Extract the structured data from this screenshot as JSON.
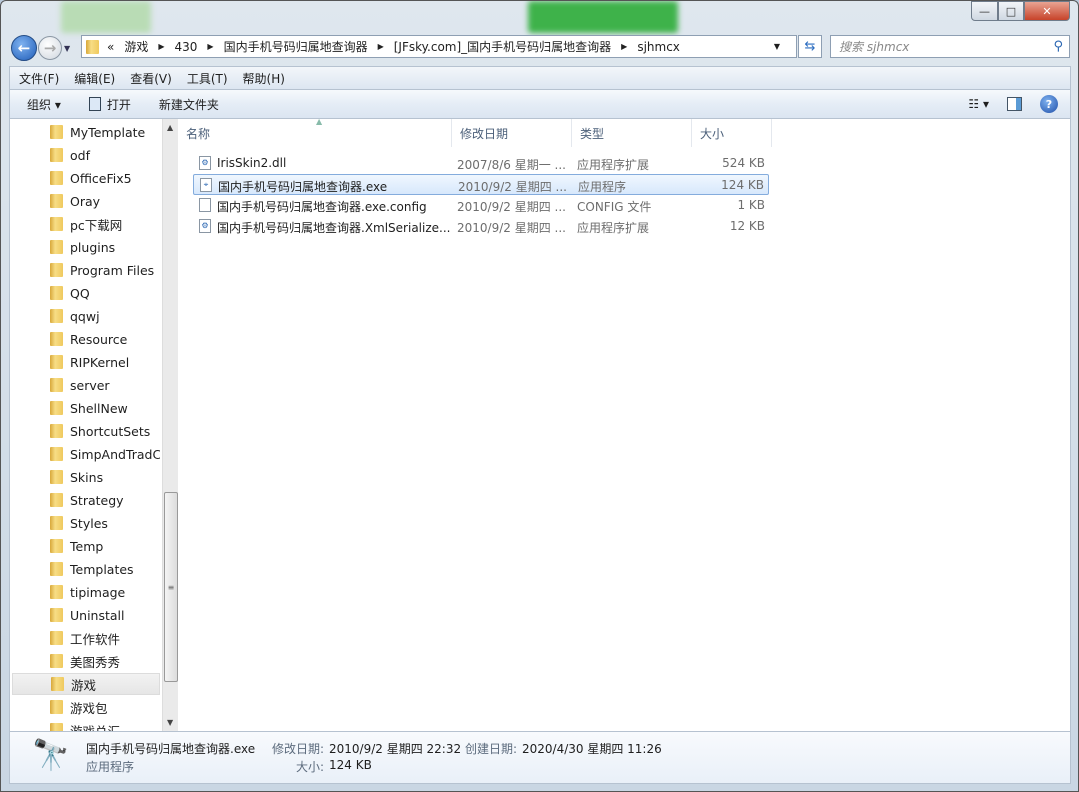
{
  "window": {
    "minimize": "—",
    "maximize": "□",
    "close": "✕"
  },
  "address": {
    "overflow": "«",
    "crumbs": [
      "游戏",
      "430",
      "国内手机号码归属地查询器",
      "[JFsky.com]_国内手机号码归属地查询器",
      "sjhmcx"
    ]
  },
  "search": {
    "placeholder": "搜索 sjhmcx"
  },
  "menu": [
    "文件(F)",
    "编辑(E)",
    "查看(V)",
    "工具(T)",
    "帮助(H)"
  ],
  "toolbar": {
    "organize": "组织 ▾",
    "open": "打开",
    "new_folder": "新建文件夹"
  },
  "sidebar": {
    "items": [
      "MyTemplate",
      "odf",
      "OfficeFix5",
      "Oray",
      "pc下载网",
      "plugins",
      "Program Files",
      "QQ",
      "qqwj",
      "Resource",
      "RIPKernel",
      "server",
      "ShellNew",
      "ShortcutSets",
      "SimpAndTradConv",
      "Skins",
      "Strategy",
      "Styles",
      "Temp",
      "Templates",
      "tipimage",
      "Uninstall",
      "工作软件",
      "美图秀秀",
      "游戏",
      "游戏包",
      "游戏总汇"
    ],
    "selected": "游戏"
  },
  "columns": [
    "名称",
    "修改日期",
    "类型",
    "大小"
  ],
  "files": [
    {
      "name": "IrisSkin2.dll",
      "date": "2007/8/6 星期一 ...",
      "type": "应用程序扩展",
      "size": "524 KB",
      "icon": "dll-icon"
    },
    {
      "name": "国内手机号码归属地查询器.exe",
      "date": "2010/9/2 星期四 ...",
      "type": "应用程序",
      "size": "124 KB",
      "icon": "telescope-icon",
      "selected": true
    },
    {
      "name": "国内手机号码归属地查询器.exe.config",
      "date": "2010/9/2 星期四 ...",
      "type": "CONFIG 文件",
      "size": "1 KB",
      "icon": "file-icon"
    },
    {
      "name": "国内手机号码归属地查询器.XmlSerialize...",
      "date": "2010/9/2 星期四 ...",
      "type": "应用程序扩展",
      "size": "12 KB",
      "icon": "dll-icon"
    }
  ],
  "details": {
    "name": "国内手机号码归属地查询器.exe",
    "type": "应用程序",
    "modified_label": "修改日期:",
    "modified": "2010/9/2 星期四 22:32",
    "created_label": "创建日期:",
    "created": "2020/4/30 星期四 11:26",
    "size_label": "大小:",
    "size": "124 KB"
  }
}
